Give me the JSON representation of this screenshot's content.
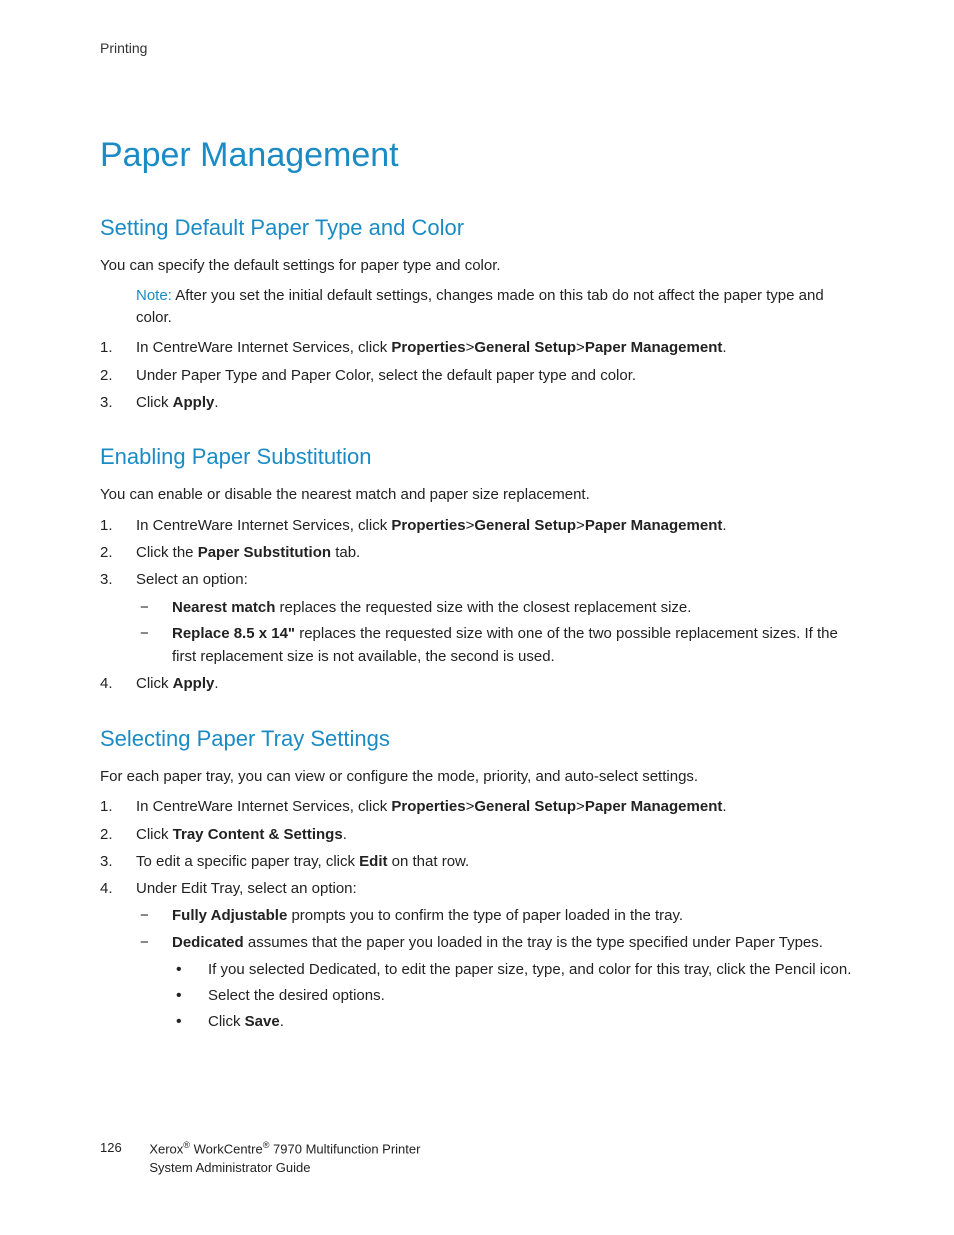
{
  "header": {
    "section": "Printing"
  },
  "title": "Paper Management",
  "sections": [
    {
      "heading": "Setting Default Paper Type and Color",
      "intro": "You can specify the default settings for paper type and color.",
      "note_label": "Note:",
      "note_text": " After you set the initial default settings, changes made on this tab do not affect the paper type and color.",
      "steps": [
        {
          "pre": "In CentreWare Internet Services, click ",
          "bold": "Properties",
          "post": ">",
          "bold2": "General Setup",
          "post2": ">",
          "bold3": "Paper Management",
          "post3": "."
        },
        {
          "text": "Under Paper Type and Paper Color, select the default paper type and color."
        },
        {
          "pre": "Click ",
          "bold": "Apply",
          "post": "."
        }
      ]
    },
    {
      "heading": "Enabling Paper Substitution",
      "intro": "You can enable or disable the nearest match and paper size replacement.",
      "steps": [
        {
          "pre": "In CentreWare Internet Services, click ",
          "bold": "Properties",
          "post": ">",
          "bold2": "General Setup",
          "post2": ">",
          "bold3": "Paper Management",
          "post3": "."
        },
        {
          "pre": "Click the ",
          "bold": "Paper Substitution",
          "post": " tab."
        },
        {
          "text": "Select an option:",
          "sub": [
            {
              "bold": "Nearest match",
              "post": " replaces the requested size with the closest replacement size."
            },
            {
              "bold": "Replace 8.5 x 14\"",
              "post": " replaces the requested size with one of the two possible replacement sizes. If the first replacement size is not available, the second is used."
            }
          ]
        },
        {
          "pre": "Click ",
          "bold": "Apply",
          "post": "."
        }
      ]
    },
    {
      "heading": "Selecting Paper Tray Settings",
      "intro": "For each paper tray, you can view or configure the mode, priority, and auto-select settings.",
      "steps": [
        {
          "pre": "In CentreWare Internet Services, click ",
          "bold": "Properties",
          "post": ">",
          "bold2": "General Setup",
          "post2": ">",
          "bold3": "Paper Management",
          "post3": "."
        },
        {
          "pre": "Click ",
          "bold": "Tray Content & Settings",
          "post": "."
        },
        {
          "pre": "To edit a specific paper tray, click ",
          "bold": "Edit",
          "post": " on that row."
        },
        {
          "text": "Under Edit Tray, select an option:",
          "sub": [
            {
              "bold": "Fully Adjustable",
              "post": " prompts you to confirm the type of paper loaded in the tray."
            },
            {
              "bold": "Dedicated",
              "post": " assumes that the paper you loaded in the tray is the type specified under Paper Types.",
              "bullets": [
                {
                  "text": "If you selected Dedicated, to edit the paper size, type, and color for this tray, click the Pencil icon."
                },
                {
                  "text": "Select the desired options."
                },
                {
                  "pre": "Click ",
                  "bold": "Save",
                  "post": "."
                }
              ]
            }
          ]
        }
      ]
    }
  ],
  "footer": {
    "page_number": "126",
    "line1_a": "Xerox",
    "line1_b": " WorkCentre",
    "line1_c": " 7970 Multifunction Printer",
    "line2": "System Administrator Guide",
    "reg": "®"
  }
}
